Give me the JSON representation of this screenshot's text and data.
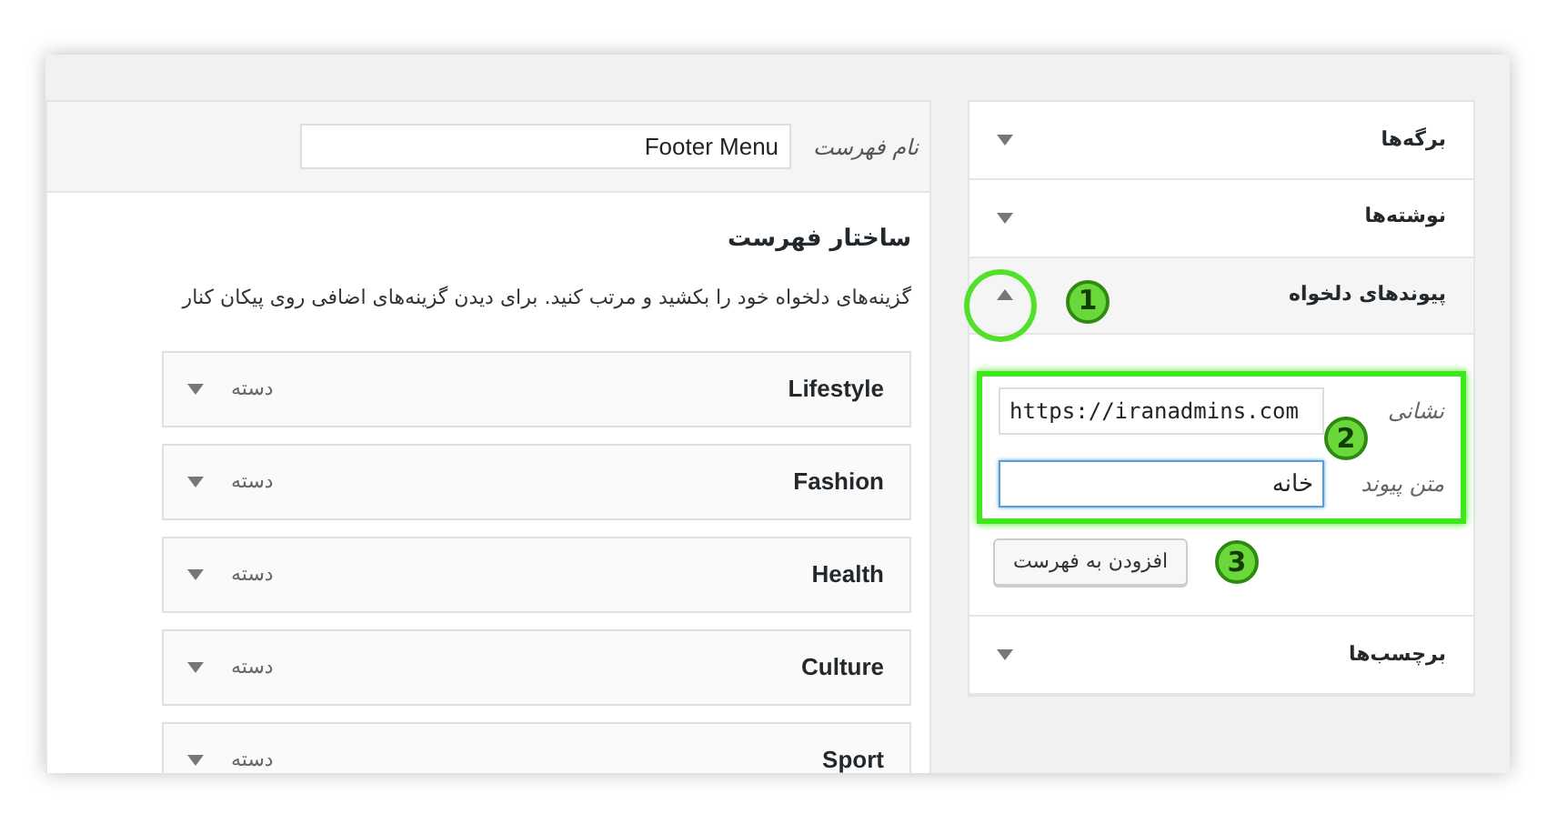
{
  "menu_name": {
    "label": "نام فهرست",
    "value": "Footer Menu"
  },
  "structure": {
    "heading": "ساختار فهرست",
    "description": "گزینه‌های دلخواه خود را بکشید و مرتب کنید. برای دیدن گزینه‌های اضافی روی پیکان کنار",
    "items": [
      {
        "title": "Lifestyle",
        "type": "دسته"
      },
      {
        "title": "Fashion",
        "type": "دسته"
      },
      {
        "title": "Health",
        "type": "دسته"
      },
      {
        "title": "Culture",
        "type": "دسته"
      },
      {
        "title": "Sport",
        "type": "دسته"
      }
    ]
  },
  "sidebar": {
    "sections": [
      {
        "title": "برگه‌ها",
        "expanded": false
      },
      {
        "title": "نوشته‌ها",
        "expanded": false
      },
      {
        "title": "پیوندهای دلخواه",
        "expanded": true,
        "callout": "1",
        "fields_callout": "2",
        "fields": [
          {
            "label": "نشانی",
            "value": "https://iranadmins.com",
            "focused": false
          },
          {
            "label": "متن پیوند",
            "value": "خانه",
            "focused": true
          }
        ],
        "button": {
          "label": "افزودن به فهرست",
          "callout": "3"
        }
      },
      {
        "title": "برچسب‌ها",
        "expanded": false
      }
    ]
  }
}
